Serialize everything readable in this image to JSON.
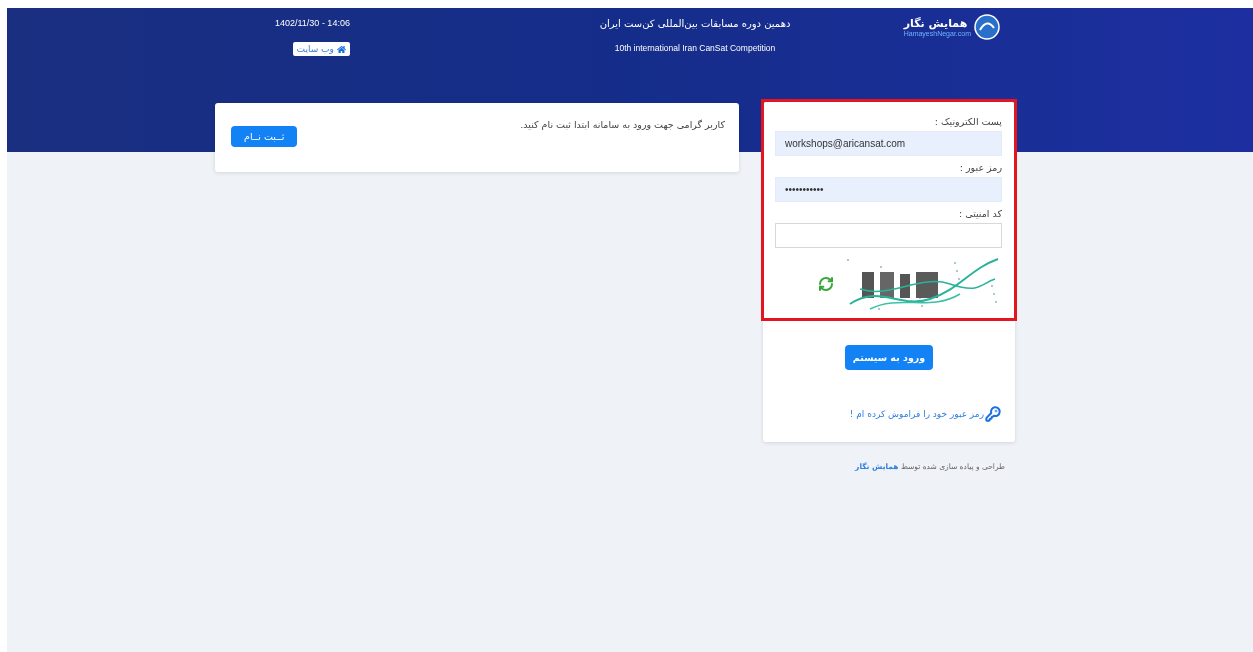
{
  "header": {
    "logo_text": "همایش نگار",
    "logo_subtext": "HamayeshNegar.com",
    "title": "دهمین دوره مسابقات بین‌المللی کن‌ست ایران",
    "subtitle": "10th international Iran CanSat Competition",
    "datetime": "1402/11/30 - 14:06",
    "website_button": "وب سایت"
  },
  "notice": {
    "message": "کاربر گرامی جهت ورود به سامانه ابتدا ثبت نام کنید.",
    "register_button": "ثــبت نــام"
  },
  "login": {
    "highlighted": true,
    "fields": [
      {
        "label": "پست الکترونیک :",
        "value": "workshops@aricansat.com",
        "autofilled": true
      },
      {
        "label": "رمز عبور :",
        "value": "•••••••••••",
        "autofilled": true
      },
      {
        "label": "کد امنیتی :",
        "autofilled": false
      }
    ],
    "submit_button": "ورود به سیستم",
    "forgot_link": "رمز عبور خود را فراموش کرده ام !"
  },
  "footer": {
    "text": "طراحی و پیاده سازی شده توسط",
    "link": "همایش نگار"
  }
}
